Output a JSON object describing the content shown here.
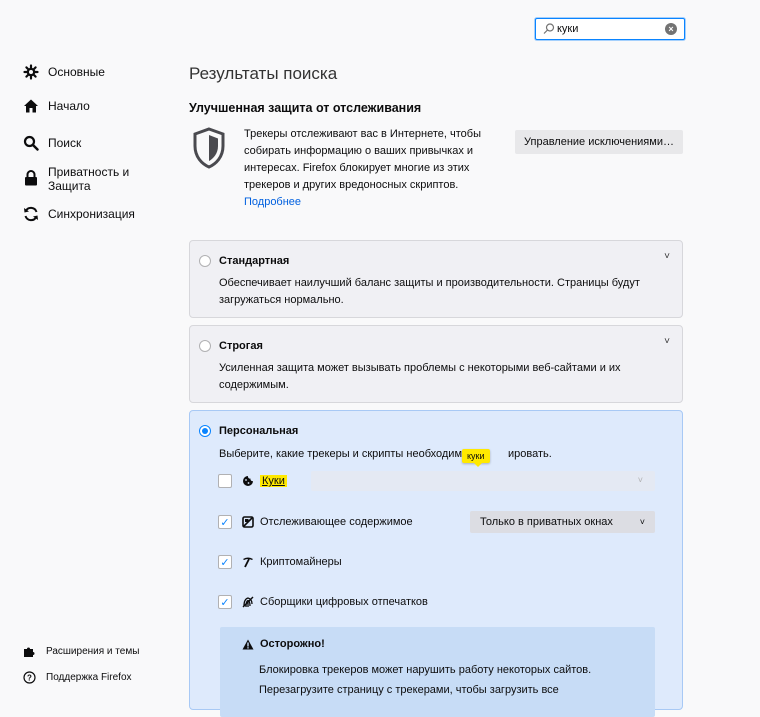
{
  "search": {
    "value": "куки"
  },
  "sidebar": {
    "items": [
      {
        "label": "Основные",
        "icon": "gear-icon"
      },
      {
        "label": "Начало",
        "icon": "home-icon"
      },
      {
        "label": "Поиск",
        "icon": "search-icon"
      },
      {
        "label": "Приватность и Защита",
        "icon": "lock-icon"
      },
      {
        "label": "Синхронизация",
        "icon": "sync-icon"
      }
    ],
    "footer": [
      {
        "label": "Расширения и темы",
        "icon": "puzzle-icon"
      },
      {
        "label": "Поддержка Firefox",
        "icon": "help-icon"
      }
    ]
  },
  "main": {
    "page_title": "Результаты поиска",
    "section_title": "Улучшенная защита от отслеживания",
    "description": "Трекеры отслеживают вас в Интернете, чтобы собирать информацию о ваших привычках и интересах. Firefox блокирует многие из этих трекеров и других вредоносных скриптов.",
    "learn_more": "Подробнее",
    "manage_button": "Управление исключениями…",
    "cards": {
      "standard": {
        "title": "Стандартная",
        "desc": "Обеспечивает наилучший баланс защиты и производительности. Страницы будут загружаться нормально."
      },
      "strict": {
        "title": "Строгая",
        "desc": "Усиленная защита может вызывать проблемы с некоторыми веб-сайтами и их содержимым."
      },
      "custom": {
        "title": "Персональная",
        "desc_a": "Выберите, какие трекеры и скрипты необходим",
        "desc_b": "ировать.",
        "tooltip": "куки",
        "options": [
          {
            "label": "Куки",
            "checked": false
          },
          {
            "label": "Отслеживающее содержимое",
            "checked": true
          },
          {
            "label": "Криптомайнеры",
            "checked": true
          },
          {
            "label": "Сборщики цифровых отпечатков",
            "checked": true
          }
        ],
        "tracking_dropdown": "Только в приватных окнах",
        "warning": {
          "title": "Осторожно!",
          "line1": "Блокировка трекеров может нарушить работу некоторых сайтов.",
          "line2": "Перезагрузите страницу с трекерами, чтобы загрузить все"
        }
      }
    }
  },
  "colors": {
    "accent": "#0a84ff",
    "highlight": "#ffe900",
    "link": "#0060df",
    "selected_card": "#deeafc"
  }
}
